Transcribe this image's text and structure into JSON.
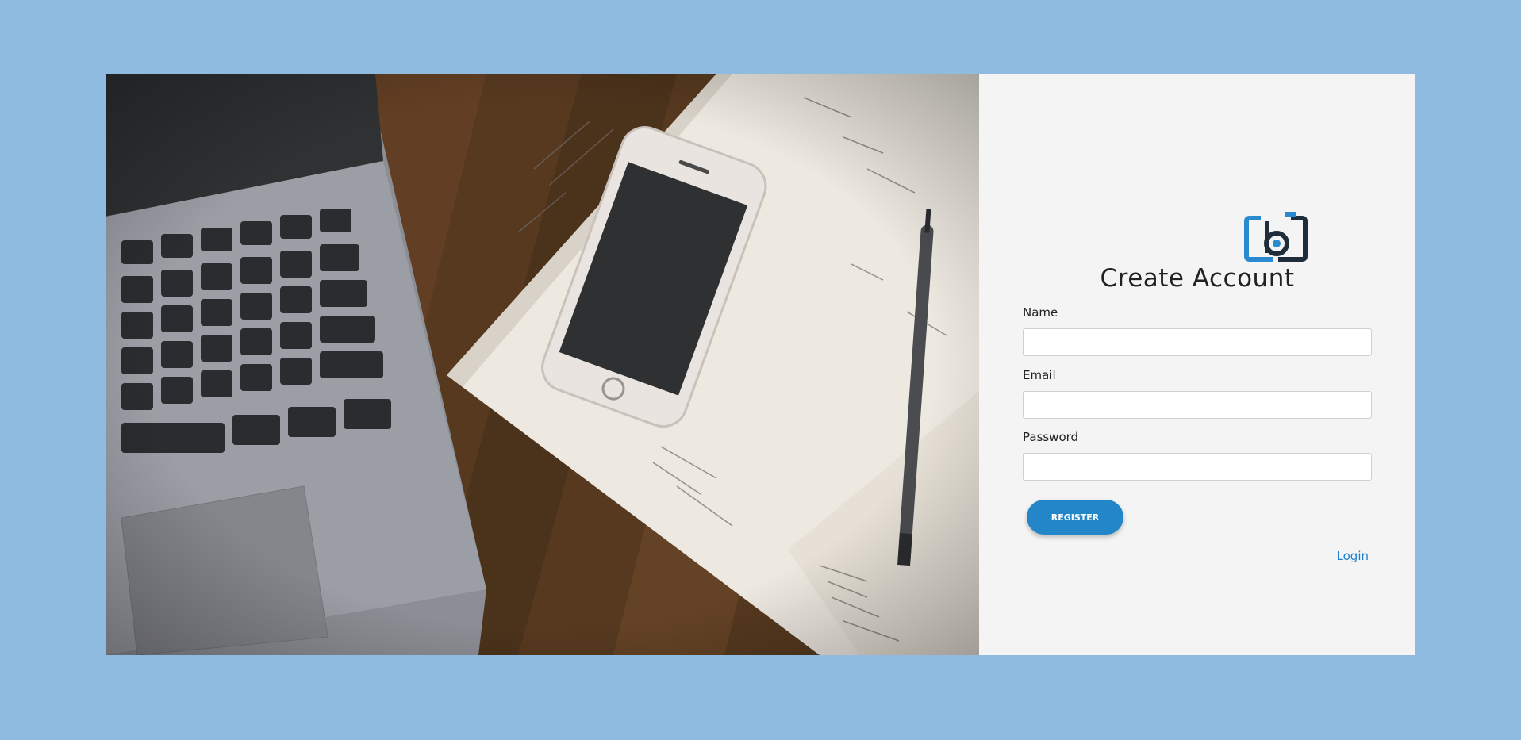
{
  "colors": {
    "page_background": "#8fbbe0",
    "panel_background": "#f4f4f4",
    "accent": "#2386c8",
    "link": "#1a7fd4",
    "logo_dark": "#1f2d3a",
    "logo_blue": "#2a8ad0"
  },
  "hero_image": {
    "icon": "laptop-phone-notebook-photo"
  },
  "brand": {
    "icon": "camera-b-logo-icon"
  },
  "form": {
    "title": "Create Account",
    "fields": [
      {
        "label": "Name",
        "value": "",
        "placeholder": ""
      },
      {
        "label": "Email",
        "value": "",
        "placeholder": ""
      },
      {
        "label": "Password",
        "value": "",
        "placeholder": ""
      }
    ],
    "register_label": "REGISTER",
    "login_label": "Login"
  }
}
